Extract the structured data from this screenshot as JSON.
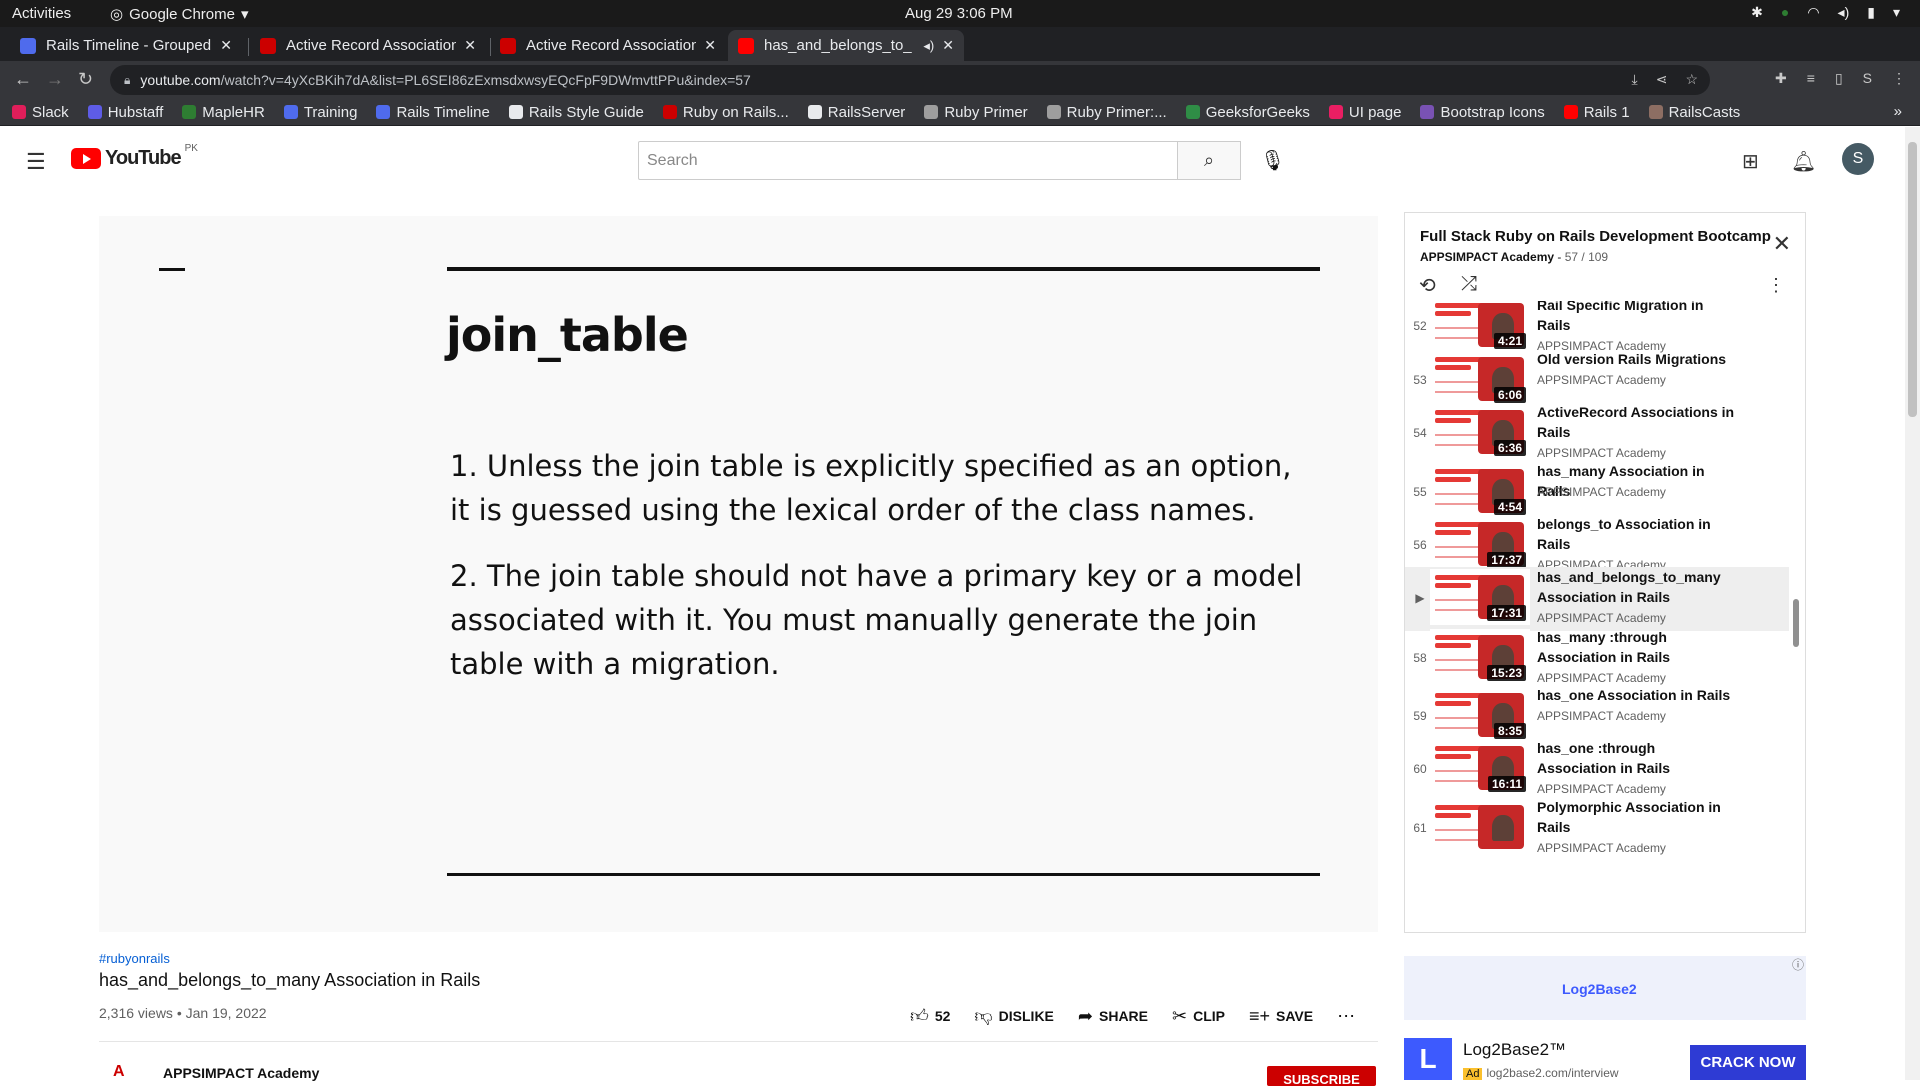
{
  "os": {
    "activities": "Activities",
    "app_name": "Google Chrome",
    "clock": "Aug 29  3:06 PM"
  },
  "tabs": [
    {
      "label": "Rails Timeline - Grouped -",
      "color": "#4f6bed"
    },
    {
      "label": "Active Record Association",
      "color": "#cc0000"
    },
    {
      "label": "Active Record Association",
      "color": "#cc0000"
    },
    {
      "label": "has_and_belongs_to_",
      "color": "#ff0000"
    }
  ],
  "address": {
    "host": "youtube.com",
    "path": "/watch?v=4yXcBKih7dA&list=PL6SEI86zExmsdxwsyEQcFpF9DWmvttPPu&index=57"
  },
  "bookmarks": [
    {
      "label": "Slack",
      "color": "#e01e5a"
    },
    {
      "label": "Hubstaff",
      "color": "#5e5ce6"
    },
    {
      "label": "MapleHR",
      "color": "#2e7d32"
    },
    {
      "label": "Training",
      "color": "#4f6bed"
    },
    {
      "label": "Rails Timeline",
      "color": "#4f6bed"
    },
    {
      "label": "Rails  Style Guide",
      "color": "#e8eaed"
    },
    {
      "label": "Ruby on Rails...",
      "color": "#cc0000"
    },
    {
      "label": "RailsServer",
      "color": "#e8eaed"
    },
    {
      "label": "Ruby Primer",
      "color": "#9e9e9e"
    },
    {
      "label": "Ruby Primer:...",
      "color": "#9e9e9e"
    },
    {
      "label": "GeeksforGeeks",
      "color": "#2f8d46"
    },
    {
      "label": "UI page",
      "color": "#e91e63"
    },
    {
      "label": "Bootstrap Icons",
      "color": "#7952b3"
    },
    {
      "label": "Rails 1",
      "color": "#ff0000"
    },
    {
      "label": "RailsCasts",
      "color": "#8d6e63"
    }
  ],
  "yt": {
    "logo": "YouTube",
    "country": "PK",
    "search_placeholder": "Search",
    "avatar": "S"
  },
  "slide": {
    "heading": "join_table",
    "points": [
      "1. Unless the join table is explicitly specified as an option, it is guessed using the lexical order of the class names.",
      "2. The join table should not have a primary key or a model associated with it. You must manually generate the join table with a migration."
    ]
  },
  "video": {
    "hashtag": "#rubyonrails",
    "title": "has_and_belongs_to_many Association in Rails",
    "meta": "2,316 views • Jan 19, 2022",
    "likes": "52",
    "dislike": "DISLIKE",
    "share": "SHARE",
    "clip": "CLIP",
    "save": "SAVE",
    "channel": "APPSIMPACT Academy",
    "subscribe": "SUBSCRIBE"
  },
  "playlist": {
    "title": "Full Stack Ruby on Rails Development Bootcamp",
    "channel": "APPSIMPACT Academy",
    "position": "57 / 109",
    "items": [
      {
        "idx": "52",
        "title": "Rail Specific Migration in Rails",
        "channel": "APPSIMPACT Academy",
        "duration": "4:21"
      },
      {
        "idx": "53",
        "title": "Old version Rails Migrations",
        "channel": "APPSIMPACT Academy",
        "duration": "6:06"
      },
      {
        "idx": "54",
        "title": "ActiveRecord Associations in Rails",
        "channel": "APPSIMPACT Academy",
        "duration": "6:36"
      },
      {
        "idx": "55",
        "title": "has_many Association in Rails",
        "channel": "APPSIMPACT Academy",
        "duration": "4:54"
      },
      {
        "idx": "56",
        "title": "belongs_to Association in Rails",
        "channel": "APPSIMPACT Academy",
        "duration": "17:37"
      },
      {
        "idx": "▶",
        "title": "has_and_belongs_to_many Association in Rails",
        "channel": "APPSIMPACT Academy",
        "duration": "17:31"
      },
      {
        "idx": "58",
        "title": "has_many :through Association in Rails",
        "channel": "APPSIMPACT Academy",
        "duration": "15:23"
      },
      {
        "idx": "59",
        "title": "has_one Association in Rails",
        "channel": "APPSIMPACT Academy",
        "duration": "8:35"
      },
      {
        "idx": "60",
        "title": "has_one :through Association in Rails",
        "channel": "APPSIMPACT Academy",
        "duration": "16:11"
      },
      {
        "idx": "61",
        "title": "Polymorphic Association in Rails",
        "channel": "APPSIMPACT Academy",
        "duration": ""
      }
    ]
  },
  "ad": {
    "logo": "Log2Base2",
    "name": "Log2Base2™",
    "tag": "Ad",
    "url": "log2base2.com/interview",
    "cta": "CRACK NOW"
  }
}
